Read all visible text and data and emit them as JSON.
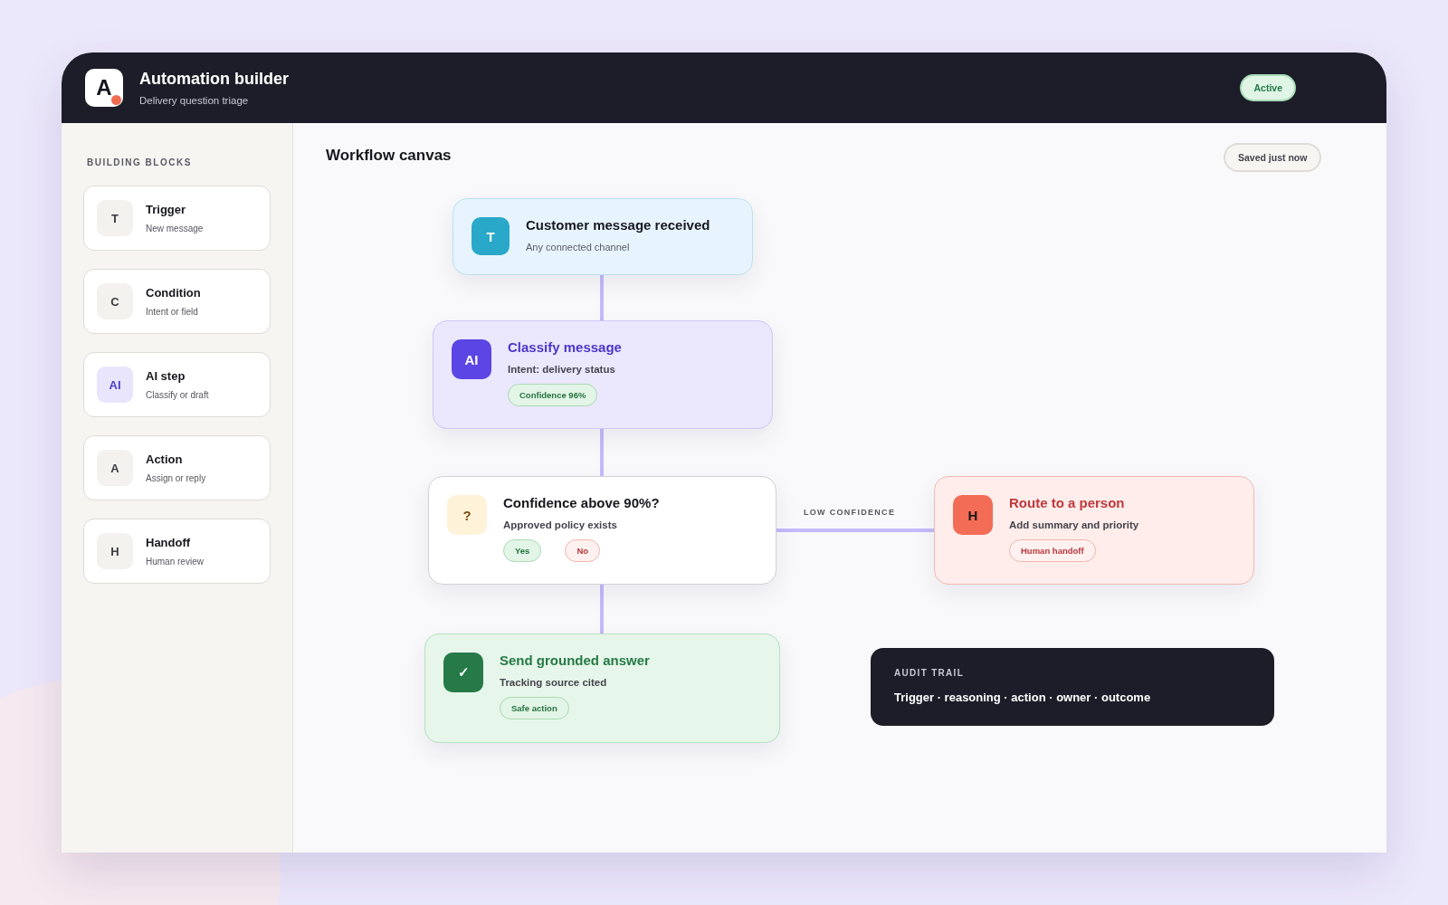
{
  "header": {
    "logo_letter": "A",
    "title": "Automation builder",
    "subtitle": "Delivery question triage",
    "status": "Active"
  },
  "sidebar": {
    "heading": "BUILDING BLOCKS",
    "blocks": [
      {
        "kind": "trigger",
        "icon": "T",
        "title": "Trigger",
        "subtitle": "New message"
      },
      {
        "kind": "condition",
        "icon": "C",
        "title": "Condition",
        "subtitle": "Intent or field"
      },
      {
        "kind": "ai",
        "icon": "AI",
        "title": "AI step",
        "subtitle": "Classify or draft"
      },
      {
        "kind": "action",
        "icon": "A",
        "title": "Action",
        "subtitle": "Assign or reply"
      },
      {
        "kind": "handoff",
        "icon": "H",
        "title": "Handoff",
        "subtitle": "Human review"
      }
    ]
  },
  "canvas": {
    "title": "Workflow canvas",
    "save_status": "Saved just now",
    "nodes": [
      {
        "kind": "trigger",
        "icon": "T",
        "title": "Customer message received",
        "subtitle": "Any connected channel"
      },
      {
        "kind": "ai",
        "icon": "AI",
        "title": "Classify message",
        "subtitle": "Intent: delivery status",
        "tags": [
          {
            "label": "Confidence 96%",
            "kind": "success"
          }
        ]
      },
      {
        "kind": "condition",
        "icon": "?",
        "title": "Confidence above 90%?",
        "subtitle": "Approved policy exists",
        "tags": [
          {
            "label": "Yes",
            "kind": "success"
          },
          {
            "label": "No",
            "kind": "danger"
          }
        ]
      },
      {
        "kind": "action",
        "icon": "✓",
        "title": "Send grounded answer",
        "subtitle": "Tracking source cited",
        "tags": [
          {
            "label": "Safe action",
            "kind": "success"
          }
        ]
      },
      {
        "kind": "handoff",
        "icon": "H",
        "title": "Route to a person",
        "subtitle": "Add summary and priority",
        "tags": [
          {
            "label": "Human handoff",
            "kind": "danger"
          }
        ]
      }
    ],
    "edge_label": "LOW CONFIDENCE",
    "audit": {
      "heading": "AUDIT TRAIL",
      "text": "Trigger · reasoning · action · owner · outcome"
    }
  }
}
